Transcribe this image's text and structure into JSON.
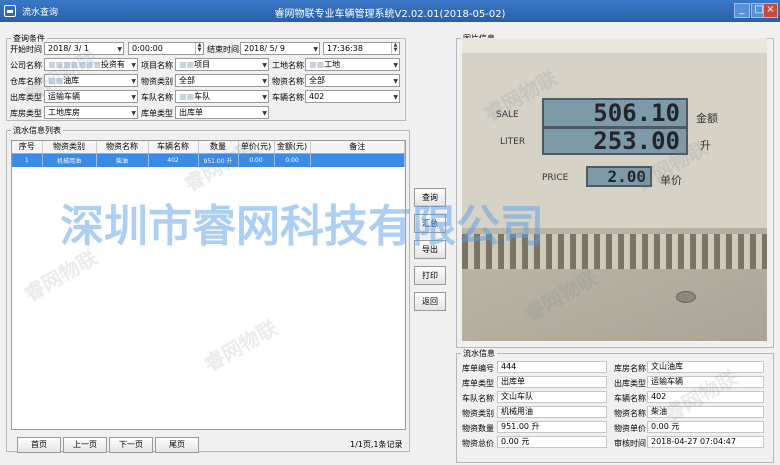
{
  "window": {
    "small_title": "流水查询",
    "title": "睿网物联专业车辆管理系统V2.02.01(2018-05-02)",
    "min": "_",
    "max": "□",
    "close": "×"
  },
  "query": {
    "group_title": "查询条件",
    "start_label": "开始时间",
    "start_date": "2018/ 3/ 1",
    "start_time": "0:00:00",
    "end_label": "结束时间",
    "end_date": "2018/ 5/ 9",
    "end_time": "17:36:38",
    "company_label": "公司名称",
    "company_value": "投资有",
    "project_label": "项目名称",
    "project_value": "项目",
    "site_label": "工地名称",
    "site_value": "工地",
    "warehouse_label": "仓库名称",
    "warehouse_value": "油库",
    "mat_type_label": "物资类别",
    "mat_type_value": "全部",
    "mat_name_label": "物资名称",
    "mat_name_value": "全部",
    "outtype_label": "出库类型",
    "outtype_value": "运输车辆",
    "fleet_label": "车队名称",
    "fleet_value": "车队",
    "vehicle_label": "车辆名称",
    "vehicle_value": "402",
    "storetype_label": "库房类型",
    "storetype_value": "工地库房",
    "doctype_label": "库单类型",
    "doctype_value": "出库单"
  },
  "list": {
    "group_title": "流水信息列表",
    "columns": [
      "序号",
      "物资类别",
      "物资名称",
      "车辆名称",
      "数量",
      "单价(元)",
      "金额(元)",
      "备注"
    ],
    "rows": [
      [
        "1",
        "机械用油",
        "柴油",
        "402",
        "951.00 升",
        "0.00",
        "0.00",
        ""
      ]
    ]
  },
  "actions": {
    "query": "查询",
    "summary": "汇总",
    "export": "导出",
    "print": "打印",
    "back": "返回"
  },
  "pager": {
    "first": "首页",
    "prev": "上一页",
    "next": "下一页",
    "last": "尾页",
    "status": "1/1页,1条记录"
  },
  "photo": {
    "group_title": "图片信息",
    "sale_label": "SALE",
    "sale_value": "506.10",
    "liter_label": "LITER",
    "liter_value": "253.00",
    "price_label": "PRICE",
    "price_value": "2.00",
    "amount_cn": "金额",
    "liter_cn": "升",
    "price_cn": "单价"
  },
  "info": {
    "group_title": "流水信息",
    "doc_no_label": "库单编号",
    "doc_no": "444",
    "store_name_label": "库房名称",
    "store_name": "文山油库",
    "doc_type_label": "库单类型",
    "doc_type": "出库单",
    "out_type_label": "出库类型",
    "out_type": "运输车辆",
    "fleet_label": "车队名称",
    "fleet": "文山车队",
    "vehicle_label": "车辆名称",
    "vehicle": "402",
    "mat_cat_label": "物资类别",
    "mat_cat": "机械用油",
    "mat_name_label": "物资名称",
    "mat_name": "柴油",
    "qty_label": "物资数量",
    "qty": "951.00 升",
    "price_label": "物资单价",
    "price": "0.00 元",
    "total_label": "物资总价",
    "total": "0.00 元",
    "audit_label": "审核时间",
    "audit_time": "2018-04-27 07:04:47"
  },
  "watermark": {
    "brand": "睿网物联",
    "company": "深圳市睿网科技有限公司"
  }
}
